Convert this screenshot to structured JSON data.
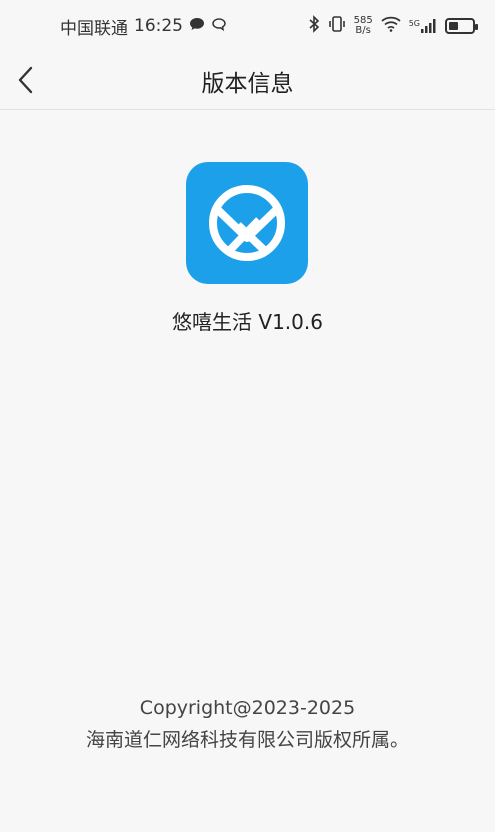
{
  "status_bar": {
    "carrier": "中国联通",
    "time": "16:25",
    "net_speed_value": "585",
    "net_speed_unit": "B/s",
    "signal_type": "5G"
  },
  "nav": {
    "title": "版本信息"
  },
  "app": {
    "name_version": "悠嘻生活 V1.0.6",
    "icon_color": "#1da0ea"
  },
  "footer": {
    "copyright": "Copyright@2023-2025",
    "owner": "海南道仁网络科技有限公司版权所属。"
  }
}
